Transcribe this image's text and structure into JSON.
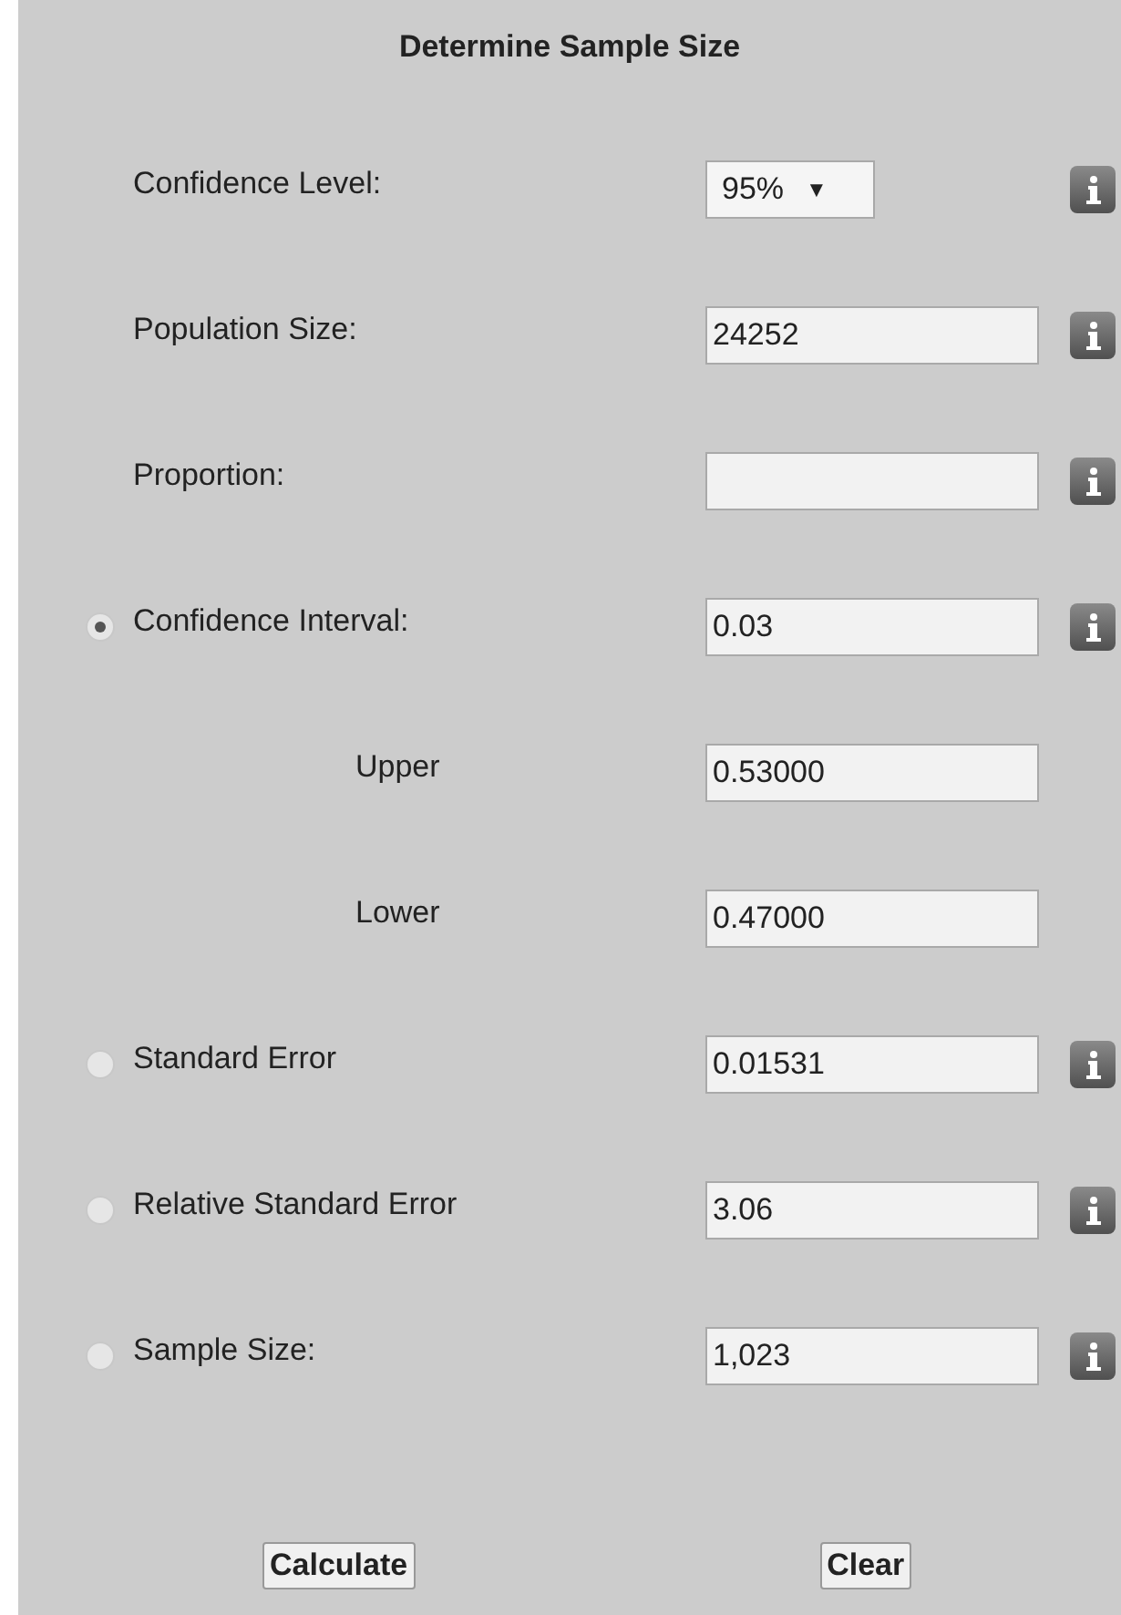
{
  "title": "Determine Sample Size",
  "rows": [
    {
      "kind": "select",
      "label": "Confidence Level:",
      "value": "95%",
      "arrow": "▼"
    },
    {
      "kind": "input",
      "label": "Population Size:",
      "value": "24252"
    },
    {
      "kind": "input",
      "label": "Proportion:"
    },
    {
      "kind": "input",
      "label": "Confidence Interval:",
      "value": "0.03",
      "selected": true
    },
    {
      "kind": "sub",
      "label": "Upper",
      "value": "0.53000"
    },
    {
      "kind": "sub",
      "label": "Lower",
      "value": "0.47000"
    },
    {
      "kind": "input",
      "label": "Standard Error",
      "value": "0.01531",
      "selected": false
    },
    {
      "kind": "input",
      "label": "Relative Standard Error",
      "value": "3.06",
      "selected": false
    },
    {
      "kind": "input",
      "label": "Sample Size:",
      "value": "1,023",
      "selected": false
    }
  ],
  "buttons": [
    "Calculate",
    "Clear"
  ]
}
